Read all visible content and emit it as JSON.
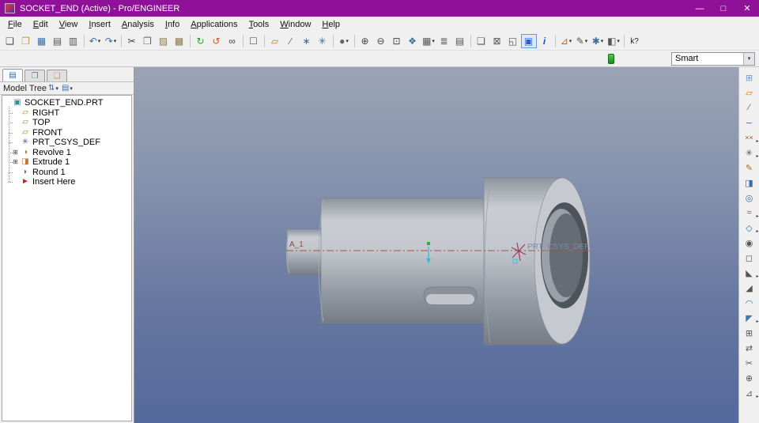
{
  "window": {
    "title": "SOCKET_END (Active) - Pro/ENGINEER",
    "controls": {
      "minimize": "—",
      "maximize": "□",
      "close": "✕"
    }
  },
  "icons": {
    "caret_down": "▾",
    "tree_show": "⇅",
    "tree_settings": "▤"
  },
  "menu": {
    "items": [
      "File",
      "Edit",
      "View",
      "Insert",
      "Analysis",
      "Info",
      "Applications",
      "Tools",
      "Window",
      "Help"
    ]
  },
  "toolbar": {
    "items": [
      {
        "cls": "tbi",
        "name": "new-file-icon",
        "glyph": "❏",
        "style": "color:#4a4a4a",
        "inter": "true"
      },
      {
        "cls": "tbi",
        "name": "open-file-icon",
        "glyph": "❐",
        "style": "color:#c8962f",
        "inter": "true"
      },
      {
        "cls": "tbi",
        "name": "save-icon",
        "glyph": "▦",
        "style": "color:#3b6ea5",
        "inter": "true"
      },
      {
        "cls": "tbi",
        "name": "print-icon",
        "glyph": "▤",
        "style": "color:#555555",
        "inter": "true"
      },
      {
        "cls": "tbi",
        "name": "print-preview-icon",
        "glyph": "▥",
        "style": "color:#555555",
        "inter": "true"
      },
      {
        "cls": "tbsep",
        "name": "separator",
        "glyph": "",
        "style": "",
        "inter": "false"
      },
      {
        "cls": "tbi",
        "name": "undo-icon",
        "glyph": "↶",
        "style": "color:#3b6ea5",
        "caret": "▾",
        "inter": "true"
      },
      {
        "cls": "tbi",
        "name": "redo-icon",
        "glyph": "↷",
        "style": "color:#3b6ea5",
        "caret": "▾",
        "inter": "true"
      },
      {
        "cls": "tbsep",
        "name": "separator",
        "glyph": "",
        "style": "",
        "inter": "false"
      },
      {
        "cls": "tbi",
        "name": "cut-icon",
        "glyph": "✂",
        "style": "color:#444444",
        "inter": "true"
      },
      {
        "cls": "tbi",
        "name": "copy-icon",
        "glyph": "❒",
        "style": "color:#666666",
        "inter": "true"
      },
      {
        "cls": "tbi",
        "name": "paste-icon",
        "glyph": "▨",
        "style": "color:#8a7a4a",
        "inter": "true"
      },
      {
        "cls": "tbi",
        "name": "paste-special-icon",
        "glyph": "▩",
        "style": "color:#8a7a4a",
        "inter": "true"
      },
      {
        "cls": "tbsep",
        "name": "separator",
        "glyph": "",
        "style": "",
        "inter": "false"
      },
      {
        "cls": "tbi",
        "name": "regenerate-icon",
        "glyph": "↻",
        "style": "color:#2f9a2f",
        "inter": "true"
      },
      {
        "cls": "tbi",
        "name": "regen-manager-icon",
        "glyph": "↺",
        "style": "color:#c06030",
        "inter": "true"
      },
      {
        "cls": "tbi",
        "name": "find-icon",
        "glyph": "∞",
        "style": "color:#444444",
        "inter": "true"
      },
      {
        "cls": "tbsep",
        "name": "separator",
        "glyph": "",
        "style": "",
        "inter": "false"
      },
      {
        "cls": "tbi",
        "name": "selection-buffer-icon",
        "glyph": "☐",
        "style": "color:#555555",
        "inter": "true"
      },
      {
        "cls": "tbsep",
        "name": "separator",
        "glyph": "",
        "style": "",
        "inter": "false"
      },
      {
        "cls": "tbi",
        "name": "datum-plane-display-icon",
        "glyph": "▱",
        "style": "color:#c07830",
        "inter": "true"
      },
      {
        "cls": "tbi",
        "name": "datum-axis-display-icon",
        "glyph": "∕",
        "style": "color:#3b6ea5",
        "inter": "true"
      },
      {
        "cls": "tbi",
        "name": "datum-point-display-icon",
        "glyph": "∗",
        "style": "color:#3b6ea5",
        "inter": "true"
      },
      {
        "cls": "tbi",
        "name": "datum-csys-display-icon",
        "glyph": "✳",
        "style": "color:#3b6ea5",
        "inter": "true"
      },
      {
        "cls": "tbsep",
        "name": "separator",
        "glyph": "",
        "style": "",
        "inter": "false"
      },
      {
        "cls": "tbi",
        "name": "display-style-icon",
        "glyph": "●",
        "style": "color:#5a6274",
        "caret": "▾",
        "inter": "true"
      },
      {
        "cls": "tbsep",
        "name": "separator",
        "glyph": "",
        "style": "",
        "inter": "false"
      },
      {
        "cls": "tbi",
        "name": "zoom-in-icon",
        "glyph": "⊕",
        "style": "color:#444444",
        "inter": "true"
      },
      {
        "cls": "tbi",
        "name": "zoom-out-icon",
        "glyph": "⊖",
        "style": "color:#444444",
        "inter": "true"
      },
      {
        "cls": "tbi",
        "name": "refit-icon",
        "glyph": "⊡",
        "style": "color:#444444",
        "inter": "true"
      },
      {
        "cls": "tbi",
        "name": "repaint-icon",
        "glyph": "❖",
        "style": "color:#3b6ea5",
        "inter": "true"
      },
      {
        "cls": "tbi",
        "name": "saved-views-icon",
        "glyph": "▦",
        "style": "color:#555555",
        "caret": "▾",
        "inter": "true"
      },
      {
        "cls": "tbi",
        "name": "layers-icon",
        "glyph": "≣",
        "style": "color:#555555",
        "inter": "true"
      },
      {
        "cls": "tbi",
        "name": "view-manager-icon",
        "glyph": "▤",
        "style": "color:#555555",
        "inter": "true"
      },
      {
        "cls": "tbsep",
        "name": "separator",
        "glyph": "",
        "style": "",
        "inter": "false"
      },
      {
        "cls": "tbi",
        "name": "new-window-icon",
        "glyph": "❏",
        "style": "color:#555555",
        "inter": "true"
      },
      {
        "cls": "tbi",
        "name": "close-window-icon",
        "glyph": "⊠",
        "style": "color:#555555",
        "inter": "true"
      },
      {
        "cls": "tbi",
        "name": "open-system-window-icon",
        "glyph": "◱",
        "style": "color:#555555",
        "inter": "true"
      },
      {
        "cls": "tbi active",
        "name": "active-window-icon",
        "glyph": "▣",
        "style": "color:#2a5fd0",
        "inter": "true"
      },
      {
        "cls": "tbi",
        "name": "model-info-icon",
        "glyph": "i",
        "style": "color:#1a4fd6;font-weight:bold;font-style:italic",
        "inter": "true"
      },
      {
        "cls": "tbsep",
        "name": "separator",
        "glyph": "",
        "style": "",
        "inter": "false"
      },
      {
        "cls": "tbi",
        "name": "measure-icon",
        "glyph": "⊿",
        "style": "color:#b06820",
        "caret": "▾",
        "inter": "true"
      },
      {
        "cls": "tbi",
        "name": "annotate-icon",
        "glyph": "✎",
        "style": "color:#555555",
        "caret": "▾",
        "inter": "true"
      },
      {
        "cls": "tbi",
        "name": "model-setup-icon",
        "glyph": "✱",
        "style": "color:#3b6ea5",
        "caret": "▾",
        "inter": "true"
      },
      {
        "cls": "tbi",
        "name": "utilities-icon",
        "glyph": "◧",
        "style": "color:#555555",
        "caret": "▾",
        "inter": "true"
      },
      {
        "cls": "tbsep",
        "name": "separator",
        "glyph": "",
        "style": "",
        "inter": "false"
      },
      {
        "cls": "tbi",
        "name": "context-help-icon",
        "glyph": "k?",
        "style": "color:#222222;font-size:10px",
        "inter": "true"
      }
    ]
  },
  "toolbar2": {
    "selection_filter_value": "Smart"
  },
  "model_tree": {
    "title": "Model Tree",
    "tabs": [
      {
        "cls": "ttab active",
        "name": "model-tree-tab",
        "glyph": "▤",
        "style": "color:#3b6ea5"
      },
      {
        "cls": "ttab",
        "name": "layer-tree-tab",
        "glyph": "❐",
        "style": "color:#3a9a4a"
      },
      {
        "cls": "ttab",
        "name": "folder-browser-tab",
        "glyph": "❏",
        "style": "color:#c79a3a"
      }
    ],
    "items": [
      {
        "cls": "trow",
        "name": "tree-item-socket-end-prt",
        "expand": "",
        "icon": "▣",
        "style": "color:#2b9090",
        "label": "SOCKET_END.PRT"
      },
      {
        "cls": "trow child",
        "name": "tree-item-right",
        "expand": "",
        "icon": "▱",
        "style": "color:#c07830",
        "label": "RIGHT"
      },
      {
        "cls": "trow child",
        "name": "tree-item-top",
        "expand": "",
        "icon": "▱",
        "style": "color:#c07830",
        "label": "TOP"
      },
      {
        "cls": "trow child",
        "name": "tree-item-front",
        "expand": "",
        "icon": "▱",
        "style": "color:#c07830",
        "label": "FRONT"
      },
      {
        "cls": "trow child",
        "name": "tree-item-prt-csys-def",
        "expand": "",
        "icon": "✳",
        "style": "color:#5a5aa0",
        "label": "PRT_CSYS_DEF"
      },
      {
        "cls": "trow child",
        "name": "tree-item-revolve-1",
        "expand": "⊞",
        "icon": "◑",
        "style": "color:#c07830",
        "label": "Revolve 1"
      },
      {
        "cls": "trow child",
        "name": "tree-item-extrude-1",
        "expand": "⊞",
        "icon": "◨",
        "style": "color:#c07830",
        "label": "Extrude 1"
      },
      {
        "cls": "trow child",
        "name": "tree-item-round-1",
        "expand": "",
        "icon": "◗",
        "style": "color:#3a7ab0",
        "label": "Round 1"
      },
      {
        "cls": "trow child",
        "name": "tree-item-insert-here",
        "expand": "",
        "icon": "►",
        "style": "color:#cc2222",
        "label": "Insert Here"
      }
    ]
  },
  "viewport": {
    "labels": {
      "axis": "A_1",
      "csys": "PRT_CSYS_DEF"
    }
  },
  "right_toolbar": {
    "items": [
      {
        "name": "window-tile-icon",
        "glyph": "⊞",
        "style": "color:#6a9ad0",
        "arrow": ""
      },
      {
        "name": "datum-plane-icon",
        "glyph": "▱",
        "style": "color:#c07830",
        "arrow": ""
      },
      {
        "name": "datum-axis-icon",
        "glyph": "∕",
        "style": "color:#8a5a30",
        "arrow": ""
      },
      {
        "name": "datum-curve-icon",
        "glyph": "∼",
        "style": "color:#8a5a30",
        "arrow": ""
      },
      {
        "name": "datum-point-icon",
        "glyph": "××",
        "style": "color:#8a5a30;font-size:9px",
        "arrow": "▸"
      },
      {
        "name": "coordinate-system-icon",
        "glyph": "✳",
        "style": "color:#555555",
        "arrow": "▸"
      },
      {
        "name": "sketch-tool-icon",
        "glyph": "✎",
        "style": "color:#b06820",
        "arrow": ""
      },
      {
        "name": "extrude-icon",
        "glyph": "◨",
        "style": "color:#3b6ea5",
        "arrow": ""
      },
      {
        "name": "revolve-icon",
        "glyph": "◎",
        "style": "color:#3b6ea5",
        "arrow": ""
      },
      {
        "name": "sweep-icon",
        "glyph": "≈",
        "style": "color:#3b6ea5",
        "arrow": "▸"
      },
      {
        "name": "blend-icon",
        "glyph": "◇",
        "style": "color:#3b6ea5",
        "arrow": "▸"
      },
      {
        "name": "hole-icon",
        "glyph": "◉",
        "style": "color:#555555",
        "arrow": ""
      },
      {
        "name": "shell-icon",
        "glyph": "◻",
        "style": "color:#555555",
        "arrow": ""
      },
      {
        "name": "rib-icon",
        "glyph": "◣",
        "style": "color:#555555",
        "arrow": "▸"
      },
      {
        "name": "draft-icon",
        "glyph": "◢",
        "style": "color:#555555",
        "arrow": ""
      },
      {
        "name": "round-icon",
        "glyph": "◠",
        "style": "color:#3a7ab0",
        "arrow": ""
      },
      {
        "name": "chamfer-icon",
        "glyph": "◤",
        "style": "color:#3a7ab0",
        "arrow": "▸"
      },
      {
        "name": "pattern-icon",
        "glyph": "⊞",
        "style": "color:#555555",
        "arrow": ""
      },
      {
        "name": "mirror-icon",
        "glyph": "⇄",
        "style": "color:#555555",
        "arrow": ""
      },
      {
        "name": "trim-icon",
        "glyph": "✂",
        "style": "color:#555555",
        "arrow": ""
      },
      {
        "name": "merge-icon",
        "glyph": "⊕",
        "style": "color:#555555",
        "arrow": ""
      },
      {
        "name": "project-icon",
        "glyph": "⊿",
        "style": "color:#555555",
        "arrow": "▸"
      }
    ]
  }
}
